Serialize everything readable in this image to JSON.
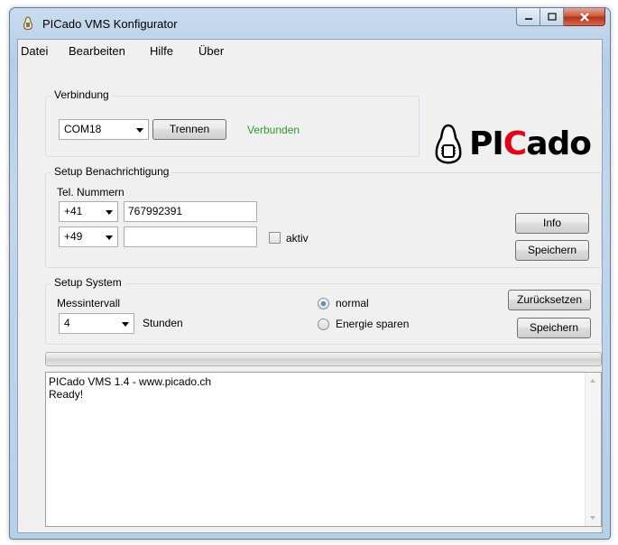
{
  "window": {
    "title": "PICado VMS Konfigurator"
  },
  "menu": [
    {
      "label": "Datei"
    },
    {
      "label": "Bearbeiten"
    },
    {
      "label": "Hilfe"
    },
    {
      "label": "Über"
    }
  ],
  "connection": {
    "group_title": "Verbindung",
    "port_value": "COM18",
    "disconnect_label": "Trennen",
    "status_text": "Verbunden",
    "status_color": "#2e9a2e"
  },
  "logo": {
    "text_prefix": "PI",
    "text_red": "C",
    "text_suffix": "ado",
    "accent_color": "#e3001b",
    "icon": "pear-chip-icon"
  },
  "notification": {
    "group_title": "Setup Benachrichtigung",
    "phone_label": "Tel. Nummern",
    "row1_prefix": "+41",
    "row1_number": "767992391",
    "row2_prefix": "+49",
    "row2_number": "",
    "active_label": "aktiv",
    "active_checked": false,
    "info_label": "Info",
    "save_label": "Speichern"
  },
  "system": {
    "group_title": "Setup System",
    "interval_label": "Messintervall",
    "interval_value": "4",
    "interval_unit": "Stunden",
    "mode_normal_label": "normal",
    "mode_energy_label": "Energie sparen",
    "mode_selected": "normal",
    "reset_label": "Zurücksetzen",
    "save_label": "Speichern"
  },
  "progress": {
    "value_percent": 0
  },
  "log": {
    "lines": [
      "PICado VMS 1.4 - www.picado.ch",
      "Ready!"
    ]
  }
}
